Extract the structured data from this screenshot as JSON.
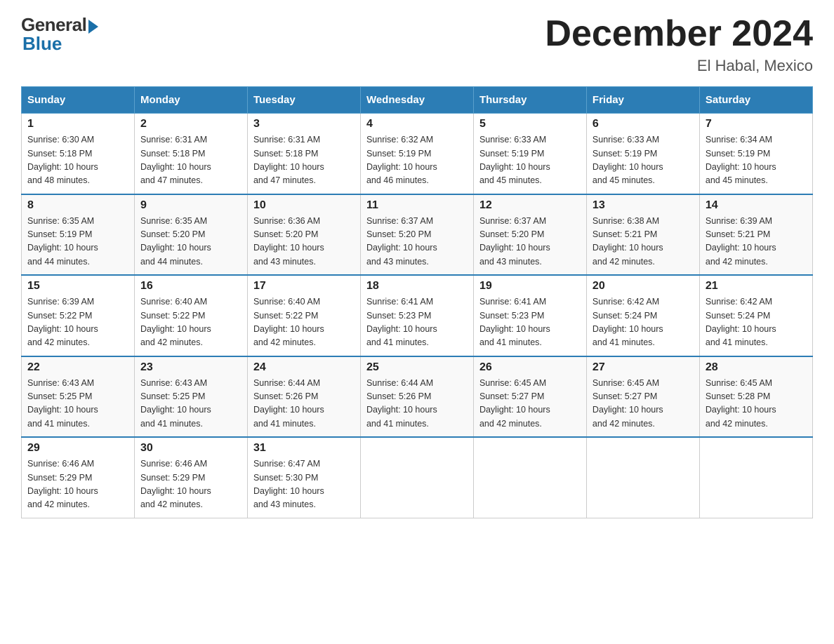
{
  "logo": {
    "general": "General",
    "blue": "Blue"
  },
  "header": {
    "title": "December 2024",
    "subtitle": "El Habal, Mexico"
  },
  "weekdays": [
    "Sunday",
    "Monday",
    "Tuesday",
    "Wednesday",
    "Thursday",
    "Friday",
    "Saturday"
  ],
  "weeks": [
    [
      {
        "day": "1",
        "sunrise": "6:30 AM",
        "sunset": "5:18 PM",
        "daylight": "10 hours and 48 minutes."
      },
      {
        "day": "2",
        "sunrise": "6:31 AM",
        "sunset": "5:18 PM",
        "daylight": "10 hours and 47 minutes."
      },
      {
        "day": "3",
        "sunrise": "6:31 AM",
        "sunset": "5:18 PM",
        "daylight": "10 hours and 47 minutes."
      },
      {
        "day": "4",
        "sunrise": "6:32 AM",
        "sunset": "5:19 PM",
        "daylight": "10 hours and 46 minutes."
      },
      {
        "day": "5",
        "sunrise": "6:33 AM",
        "sunset": "5:19 PM",
        "daylight": "10 hours and 45 minutes."
      },
      {
        "day": "6",
        "sunrise": "6:33 AM",
        "sunset": "5:19 PM",
        "daylight": "10 hours and 45 minutes."
      },
      {
        "day": "7",
        "sunrise": "6:34 AM",
        "sunset": "5:19 PM",
        "daylight": "10 hours and 45 minutes."
      }
    ],
    [
      {
        "day": "8",
        "sunrise": "6:35 AM",
        "sunset": "5:19 PM",
        "daylight": "10 hours and 44 minutes."
      },
      {
        "day": "9",
        "sunrise": "6:35 AM",
        "sunset": "5:20 PM",
        "daylight": "10 hours and 44 minutes."
      },
      {
        "day": "10",
        "sunrise": "6:36 AM",
        "sunset": "5:20 PM",
        "daylight": "10 hours and 43 minutes."
      },
      {
        "day": "11",
        "sunrise": "6:37 AM",
        "sunset": "5:20 PM",
        "daylight": "10 hours and 43 minutes."
      },
      {
        "day": "12",
        "sunrise": "6:37 AM",
        "sunset": "5:20 PM",
        "daylight": "10 hours and 43 minutes."
      },
      {
        "day": "13",
        "sunrise": "6:38 AM",
        "sunset": "5:21 PM",
        "daylight": "10 hours and 42 minutes."
      },
      {
        "day": "14",
        "sunrise": "6:39 AM",
        "sunset": "5:21 PM",
        "daylight": "10 hours and 42 minutes."
      }
    ],
    [
      {
        "day": "15",
        "sunrise": "6:39 AM",
        "sunset": "5:22 PM",
        "daylight": "10 hours and 42 minutes."
      },
      {
        "day": "16",
        "sunrise": "6:40 AM",
        "sunset": "5:22 PM",
        "daylight": "10 hours and 42 minutes."
      },
      {
        "day": "17",
        "sunrise": "6:40 AM",
        "sunset": "5:22 PM",
        "daylight": "10 hours and 42 minutes."
      },
      {
        "day": "18",
        "sunrise": "6:41 AM",
        "sunset": "5:23 PM",
        "daylight": "10 hours and 41 minutes."
      },
      {
        "day": "19",
        "sunrise": "6:41 AM",
        "sunset": "5:23 PM",
        "daylight": "10 hours and 41 minutes."
      },
      {
        "day": "20",
        "sunrise": "6:42 AM",
        "sunset": "5:24 PM",
        "daylight": "10 hours and 41 minutes."
      },
      {
        "day": "21",
        "sunrise": "6:42 AM",
        "sunset": "5:24 PM",
        "daylight": "10 hours and 41 minutes."
      }
    ],
    [
      {
        "day": "22",
        "sunrise": "6:43 AM",
        "sunset": "5:25 PM",
        "daylight": "10 hours and 41 minutes."
      },
      {
        "day": "23",
        "sunrise": "6:43 AM",
        "sunset": "5:25 PM",
        "daylight": "10 hours and 41 minutes."
      },
      {
        "day": "24",
        "sunrise": "6:44 AM",
        "sunset": "5:26 PM",
        "daylight": "10 hours and 41 minutes."
      },
      {
        "day": "25",
        "sunrise": "6:44 AM",
        "sunset": "5:26 PM",
        "daylight": "10 hours and 41 minutes."
      },
      {
        "day": "26",
        "sunrise": "6:45 AM",
        "sunset": "5:27 PM",
        "daylight": "10 hours and 42 minutes."
      },
      {
        "day": "27",
        "sunrise": "6:45 AM",
        "sunset": "5:27 PM",
        "daylight": "10 hours and 42 minutes."
      },
      {
        "day": "28",
        "sunrise": "6:45 AM",
        "sunset": "5:28 PM",
        "daylight": "10 hours and 42 minutes."
      }
    ],
    [
      {
        "day": "29",
        "sunrise": "6:46 AM",
        "sunset": "5:29 PM",
        "daylight": "10 hours and 42 minutes."
      },
      {
        "day": "30",
        "sunrise": "6:46 AM",
        "sunset": "5:29 PM",
        "daylight": "10 hours and 42 minutes."
      },
      {
        "day": "31",
        "sunrise": "6:47 AM",
        "sunset": "5:30 PM",
        "daylight": "10 hours and 43 minutes."
      },
      null,
      null,
      null,
      null
    ]
  ],
  "labels": {
    "sunrise": "Sunrise:",
    "sunset": "Sunset:",
    "daylight": "Daylight:"
  }
}
